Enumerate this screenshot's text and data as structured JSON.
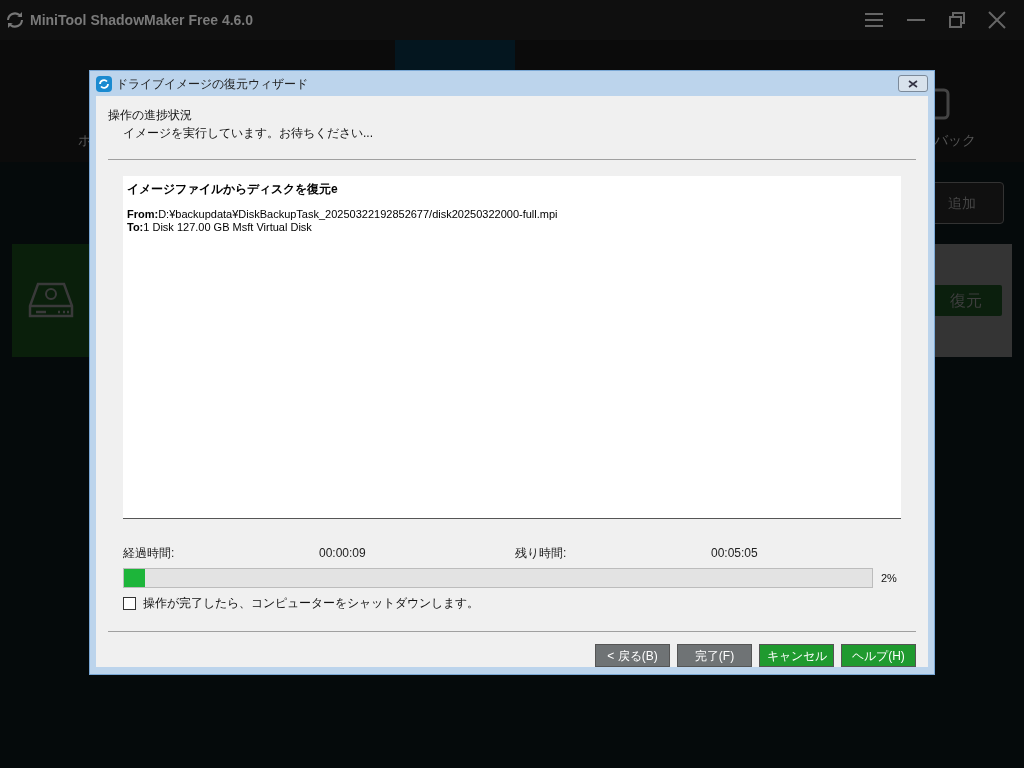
{
  "app": {
    "title": "MiniTool ShadowMaker Free 4.6.0",
    "nav_left": "ホ",
    "nav_right": "バック",
    "add_button": "追加",
    "restore_button": "復元"
  },
  "dialog": {
    "title": "ドライブイメージの復元ウィザード",
    "heading": "操作の進捗状況",
    "subheading": "イメージを実行しています。お待ちください...",
    "log": {
      "title": "イメージファイルからディスクを復元e",
      "lines": [
        {
          "label": "From:",
          "value": "D:¥backupdata¥DiskBackupTask_20250322192852677/disk20250322000-full.mpi"
        },
        {
          "label": "To:",
          "value": "1 Disk 127.00 GB Msft Virtual Disk"
        }
      ]
    },
    "elapsed_label": "経過時間:",
    "elapsed": "00:00:09",
    "remaining_label": "残り時間:",
    "remaining": "00:05:05",
    "progress": {
      "level": 0.028,
      "reading": "2%"
    },
    "shutdown": {
      "label": "操作が完了したら、コンピューターをシャットダウンします。",
      "checked": false
    },
    "buttons": [
      {
        "label": "< 戻る(B)",
        "kind": "gray"
      },
      {
        "label": "完了(F)",
        "kind": "gray"
      },
      {
        "label": "キャンセル",
        "kind": "green"
      },
      {
        "label": "ヘルプ(H)",
        "kind": "green"
      }
    ]
  }
}
